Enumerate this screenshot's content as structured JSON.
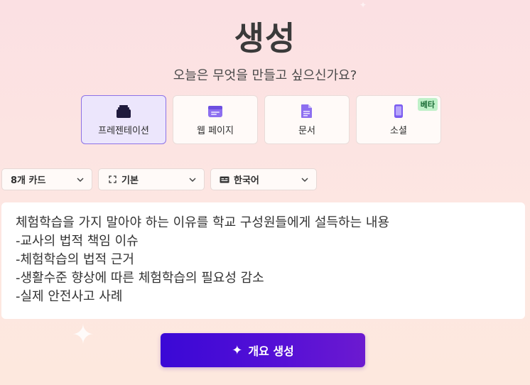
{
  "header": {
    "title": "생성",
    "subtitle": "오늘은 무엇을 만들고 싶으신가요?"
  },
  "content_types": [
    {
      "label": "프레젠테이션",
      "icon": "stack-cards-icon",
      "selected": true
    },
    {
      "label": "웹 페이지",
      "icon": "browser-window-icon",
      "selected": false
    },
    {
      "label": "문서",
      "icon": "document-icon",
      "selected": false
    },
    {
      "label": "소셜",
      "icon": "phone-icon",
      "selected": false,
      "badge": "베타"
    }
  ],
  "options": {
    "cards": {
      "value": "8개 카드"
    },
    "theme": {
      "value": "기본",
      "icon": "fullscreen-icon"
    },
    "language": {
      "value": "한국어",
      "icon": "language-icon"
    }
  },
  "prompt": {
    "lines": [
      "체험학습을 가지 말아야 하는 이유를 학교 구성원들에게 설득하는 내용",
      "-교사의 법적 책임 이슈",
      "-체험학습의 법적 근거",
      "-생활수준 향상에 따른 체험학습의 필요성 감소",
      "-실제 안전사고 사례"
    ]
  },
  "actions": {
    "generate_label": "개요 생성",
    "generate_icon": "sparkle-icon"
  },
  "colors": {
    "accent": "#4a0ed6",
    "selected_card_bg": "#ece6fc",
    "icon_purple": "#7b5cf0",
    "beta_badge_bg": "#bff0c8"
  }
}
